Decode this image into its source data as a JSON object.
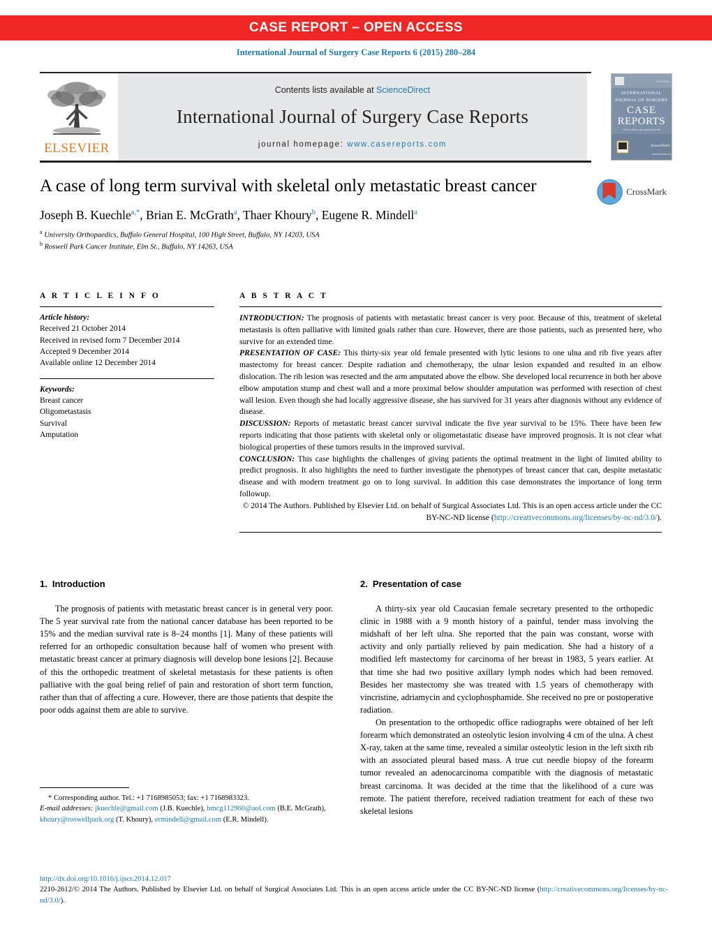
{
  "banner": {
    "text": "CASE REPORT – OPEN ACCESS"
  },
  "running_head": {
    "text": "International Journal of Surgery Case Reports 6 (2015) 280–284"
  },
  "masthead": {
    "contents_prefix": "Contents lists available at ",
    "sciencedirect": "ScienceDirect",
    "journal_title": "International Journal of Surgery Case Reports",
    "homepage_label": "journal homepage:",
    "homepage_url": "www.casereports.com",
    "publisher": "ELSEVIER",
    "cover_lines": [
      "INTERNATIONAL",
      "JOURNAL OF SURGERY",
      "CASE",
      "REPORTS"
    ]
  },
  "article": {
    "title": "A case of long term survival with skeletal only metastatic breast cancer",
    "authors": [
      {
        "name": "Joseph B. Kuechle",
        "sup": "a,*"
      },
      {
        "name": "Brian E. McGrath",
        "sup": "a"
      },
      {
        "name": "Thaer Khoury",
        "sup": "b"
      },
      {
        "name": "Eugene R. Mindell",
        "sup": "a"
      }
    ],
    "affiliations": [
      {
        "marker": "a",
        "text": "University Orthopaedics, Buffalo General Hospital, 100 High Street, Buffalo, NY 14203, USA"
      },
      {
        "marker": "b",
        "text": "Roswell Park Cancer Institute, Elm St., Buffalo, NY 14263, USA"
      }
    ],
    "crossmark_label": "CrossMark"
  },
  "article_info": {
    "heading": "A R T I C L E    I N F O",
    "history_label": "Article history:",
    "history": [
      "Received 21 October 2014",
      "Received in revised form 7 December 2014",
      "Accepted 9 December 2014",
      "Available online 12 December 2014"
    ],
    "keywords_label": "Keywords:",
    "keywords": [
      "Breast cancer",
      "Oligometastasis",
      "Survival",
      "Amputation"
    ]
  },
  "abstract": {
    "heading": "A B S T R A C T",
    "sections": [
      {
        "lead": "INTRODUCTION:",
        "text": " The prognosis of patients with metastatic breast cancer is very poor. Because of this, treatment of skeletal metastasis is often palliative with limited goals rather than cure. However, there are those patients, such as presented here, who survive for an extended time."
      },
      {
        "lead": "PRESENTATION OF CASE:",
        "text": " This thirty-six year old female presented with lytic lesions to one ulna and rib five years after mastectomy for breast cancer. Despite radiation and chemotherapy, the ulnar lesion expanded and resulted in an elbow dislocation. The rib lesion was resected and the arm amputated above the elbow. She developed local recurrence in both her above elbow amputation stump and chest wall and a more proximal below shoulder amputation was performed with resection of chest wall lesion. Even though she had locally aggressive disease, she has survived for 31 years after diagnosis without any evidence of disease."
      },
      {
        "lead": "DISCUSSION:",
        "text": " Reports of metastatic breast cancer survival indicate the five year survival to be 15%. There have been few reports indicating that those patients with skeletal only or oligometastatic disease have improved prognosis. It is not clear what biological properties of these tumors results in the improved survival."
      },
      {
        "lead": "CONCLUSION:",
        "text": " This case highlights the challenges of giving patients the optimal treatment in the light of limited ability to predict prognosis. It also highlights the need to further investigate the phenotypes of breast cancer that can, despite metastatic disease and with modern treatment go on to long survival. In addition this case demonstrates the importance of long term followup."
      }
    ],
    "copyright_text": "© 2014 The Authors. Published by Elsevier Ltd. on behalf of Surgical Associates Ltd. This is an open access article under the CC BY-NC-ND license (",
    "copyright_link": "http://creativecommons.org/licenses/by-nc-nd/3.0/",
    "copyright_tail": ")."
  },
  "body": {
    "left": {
      "section_number": "1.",
      "section_title": "Introduction",
      "paragraphs": [
        "The prognosis of patients with metastatic breast cancer is in general very poor. The 5 year survival rate from the national cancer database has been reported to be 15% and the median survival rate is 8–24 months [1]. Many of these patients will referred for an orthopedic consultation because half of women who present with metastatic breast cancer at primary diagnosis will develop bone lesions [2]. Because of this the orthopedic treatment of skeletal metastasis for these patients is often palliative with the goal being relief of pain and restoration of short term function, rather than that of affecting a cure. However, there are those patients that despite the poor odds against them are able to survive."
      ]
    },
    "right": {
      "section_number": "2.",
      "section_title": "Presentation of case",
      "paragraphs": [
        "A thirty-six year old Caucasian female secretary presented to the orthopedic clinic in 1988 with a 9 month history of a painful, tender mass involving the midshaft of her left ulna. She reported that the pain was constant, worse with activity and only partially relieved by pain medication. She had a history of a modified left mastectomy for carcinoma of her breast in 1983, 5 years earlier. At that time she had two positive axillary lymph nodes which had been removed. Besides her mastectomy she was treated with 1.5 years of chemotherapy with vincristine, adriamycin and cyclophosphamide. She received no pre or postoperative radiation.",
        "On presentation to the orthopedic office radiographs were obtained of her left forearm which demonstrated an osteolytic lesion involving 4 cm of the ulna. A chest X-ray, taken at the same time, revealed a similar osteolytic lesion in the left sixth rib with an associated pleural based mass. A true cut needle biopsy of the forearm tumor revealed an adenocarcinoma compatible with the diagnosis of metastatic breast carcinoma. It was decided at the time that the likelihood of a cure was remote. The patient therefore, received radiation treatment for each of these two skeletal lesions"
      ]
    }
  },
  "footnotes": {
    "corresponding": "* Corresponding author. Tel.: +1 7168985053; fax: +1 7168983323.",
    "email_label": "E-mail addresses:",
    "emails": [
      {
        "address": "jkuechle@gmail.com",
        "owner": "(J.B. Kuechle),"
      },
      {
        "address": "bmcg112960@aol.com",
        "owner": "(B.E. McGrath),"
      },
      {
        "address": "khoury@roswellpark.org",
        "owner": "(T. Khoury),"
      },
      {
        "address": "ermindell@gmail.com",
        "owner": "(E.R. Mindell)."
      }
    ]
  },
  "bottom": {
    "doi": "http://dx.doi.org/10.1016/j.ijscr.2014.12.017",
    "issn_line": "2210-2612/© 2014 The Authors. Published by Elsevier Ltd. on behalf of Surgical Associates Ltd. This is an open access article under the CC BY-NC-ND license",
    "license_link": "http://creativecommons.org/licenses/by-nc-nd/3.0/",
    "license_open": "(",
    "license_close": ")."
  },
  "colors": {
    "banner_red": "#ee2724",
    "link_blue": "#1a7aad",
    "elsevier_orange": "#e87722",
    "masthead_gray": "#e6e7e8"
  }
}
